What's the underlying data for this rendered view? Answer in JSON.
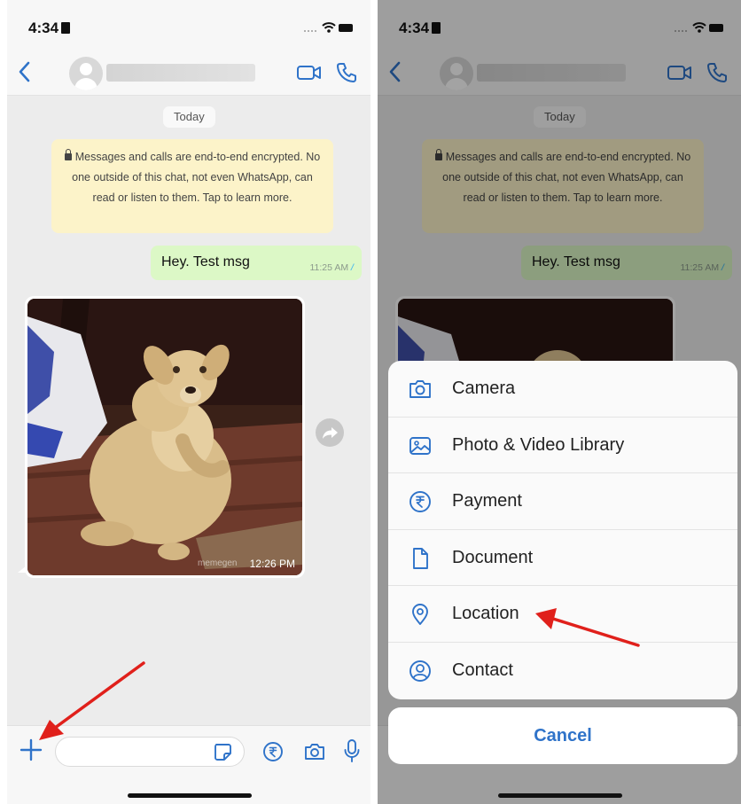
{
  "left_screen": {
    "status_time": "4:34",
    "date_chip": "Today",
    "encryption_notice": "Messages and calls are end-to-end encrypted. No one outside of this chat, not even WhatsApp, can read or listen to them. Tap to learn more.",
    "outgoing_message": {
      "text": "Hey. Test msg",
      "time": "11:25 AM"
    },
    "image_message": {
      "time": "12:26 PM",
      "watermark": "memegen"
    },
    "input_placeholder": ""
  },
  "right_screen": {
    "status_time": "4:34",
    "date_chip": "Today",
    "encryption_notice": "Messages and calls are end-to-end encrypted. No one outside of this chat, not even WhatsApp, can read or listen to them. Tap to learn more.",
    "outgoing_message": {
      "text": "Hey. Test msg",
      "time": "11:25 AM"
    },
    "attach_menu": {
      "items": [
        {
          "label": "Camera",
          "icon": "camera-icon"
        },
        {
          "label": "Photo & Video Library",
          "icon": "photo-library-icon"
        },
        {
          "label": "Payment",
          "icon": "rupee-icon"
        },
        {
          "label": "Document",
          "icon": "document-icon"
        },
        {
          "label": "Location",
          "icon": "location-pin-icon"
        },
        {
          "label": "Contact",
          "icon": "contact-icon"
        }
      ],
      "cancel_label": "Cancel"
    }
  },
  "colors": {
    "accent_blue": "#2f73c9",
    "outgoing_bubble": "#dcf8c6",
    "encryption_bubble": "#fcf3c9",
    "annotation_arrow": "#e0201b"
  }
}
